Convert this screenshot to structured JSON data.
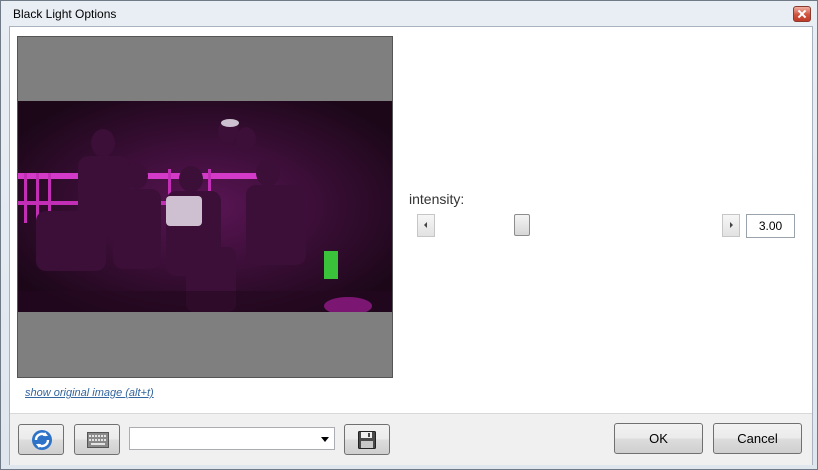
{
  "window": {
    "title": "Black Light Options"
  },
  "preview": {
    "toggle_link": "show original image (alt+t)"
  },
  "intensity": {
    "label": "intensity:",
    "value": "3.00",
    "slider_fraction": 0.295
  },
  "toolbar": {
    "preset_value": "",
    "ok_label": "OK",
    "cancel_label": "Cancel"
  },
  "icons": {
    "refresh": "refresh-icon",
    "keyboard": "keyboard-icon",
    "save": "save-icon",
    "close": "close-icon"
  },
  "colors": {
    "accent": "#3a7fc8",
    "photo_tint": "#ff00ff"
  }
}
